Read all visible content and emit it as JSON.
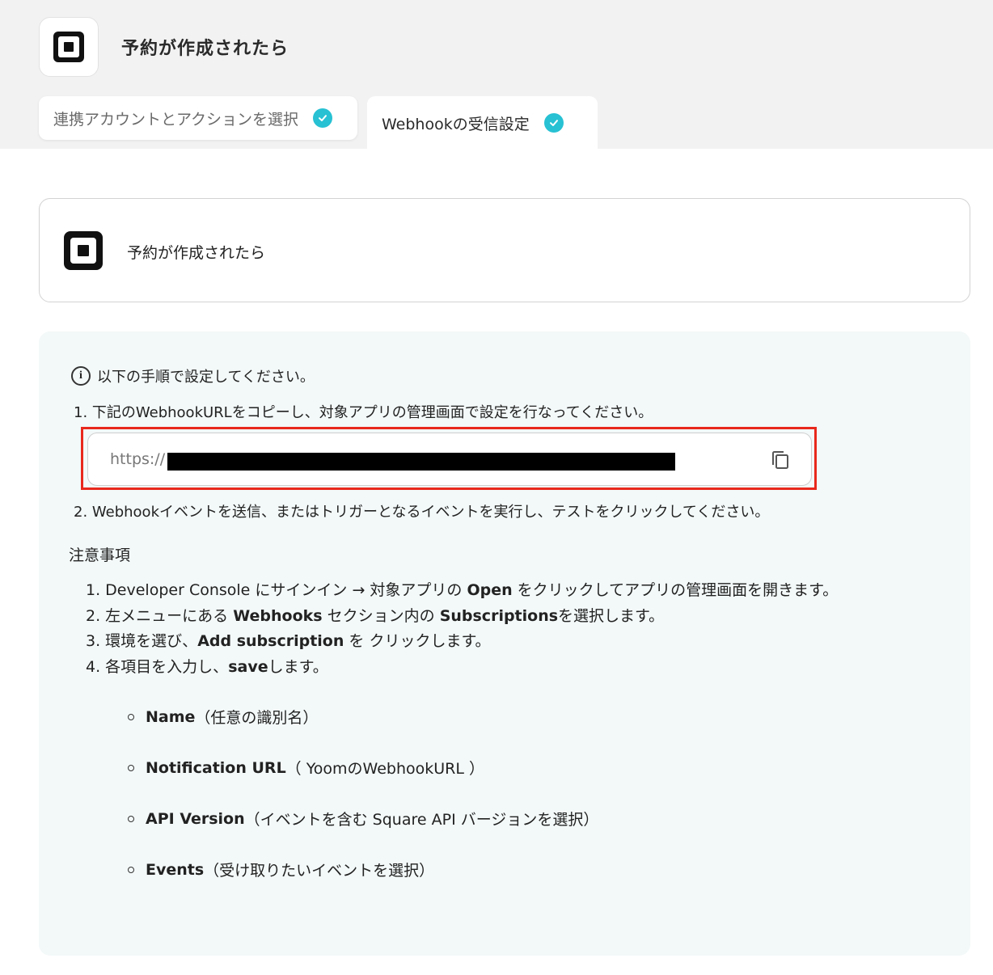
{
  "header": {
    "title": "予約が作成されたら"
  },
  "tabs": [
    {
      "label": "連携アカウントとアクションを選択",
      "completed": true
    },
    {
      "label": "Webhookの受信設定",
      "completed": true
    }
  ],
  "trigger": {
    "title": "予約が作成されたら"
  },
  "instructions": {
    "heading": "以下の手順で設定してください。",
    "step1": "1. 下記のWebhookURLをコピーし、対象アプリの管理画面で設定を行なってください。",
    "url_prefix": "https://",
    "step2": "2. Webhookイベントを送信、またはトリガーとなるイベントを実行し、テストをクリックしてください。"
  },
  "notes": {
    "title": "注意事項",
    "items": [
      {
        "num": "1.",
        "pre": " Developer Console にサインイン → 対象アプリの ",
        "bold": "Open",
        "post": " をクリックしてアプリの管理画面を開きます。"
      },
      {
        "num": "2.",
        "pre": " 左メニューにある ",
        "bold": "Webhooks",
        "post": " セクション内の ",
        "bold2": "Subscriptions",
        "post2": "を選択します。"
      },
      {
        "num": "3.",
        "pre": " 環境を選び、",
        "bold": "Add subscription",
        "post": " を クリックします。"
      },
      {
        "num": "4.",
        "pre": " 各項目を入力し、",
        "bold": "save",
        "post": "します。"
      }
    ],
    "sub_items": [
      {
        "bold": "Name",
        "rest": "（任意の識別名）"
      },
      {
        "bold": "Notification URL",
        "rest": "（ YoomのWebhookURL ）"
      },
      {
        "bold": "API Version",
        "rest": "（イベントを含む Square API バージョンを選択）"
      },
      {
        "bold": "Events",
        "rest": "（受け取りたいイベントを選択）"
      }
    ]
  },
  "colors": {
    "accent_check": "#27c1d3",
    "highlight_border": "#e8281c",
    "panel_bg": "#f3f8f8"
  }
}
